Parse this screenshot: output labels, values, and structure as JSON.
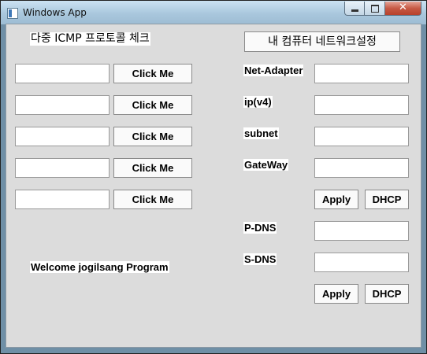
{
  "window": {
    "title": "Windows App",
    "close_symbol": "✕"
  },
  "left": {
    "heading": "다중 ICMP 프로토콜 체크",
    "rows": [
      {
        "value": "",
        "button": "Click Me"
      },
      {
        "value": "",
        "button": "Click Me"
      },
      {
        "value": "",
        "button": "Click Me"
      },
      {
        "value": "",
        "button": "Click Me"
      },
      {
        "value": "",
        "button": "Click Me"
      }
    ],
    "welcome": "Welcome jogilsang Program"
  },
  "right": {
    "network_button": "내 컴퓨터 네트워크설정",
    "labels": {
      "adapter": "Net-Adapter",
      "ip": "ip(v4)",
      "subnet": "subnet",
      "gateway": "GateWay",
      "pdns": "P-DNS",
      "sdns": "S-DNS"
    },
    "apply_label": "Apply",
    "dhcp_label": "DHCP"
  }
}
